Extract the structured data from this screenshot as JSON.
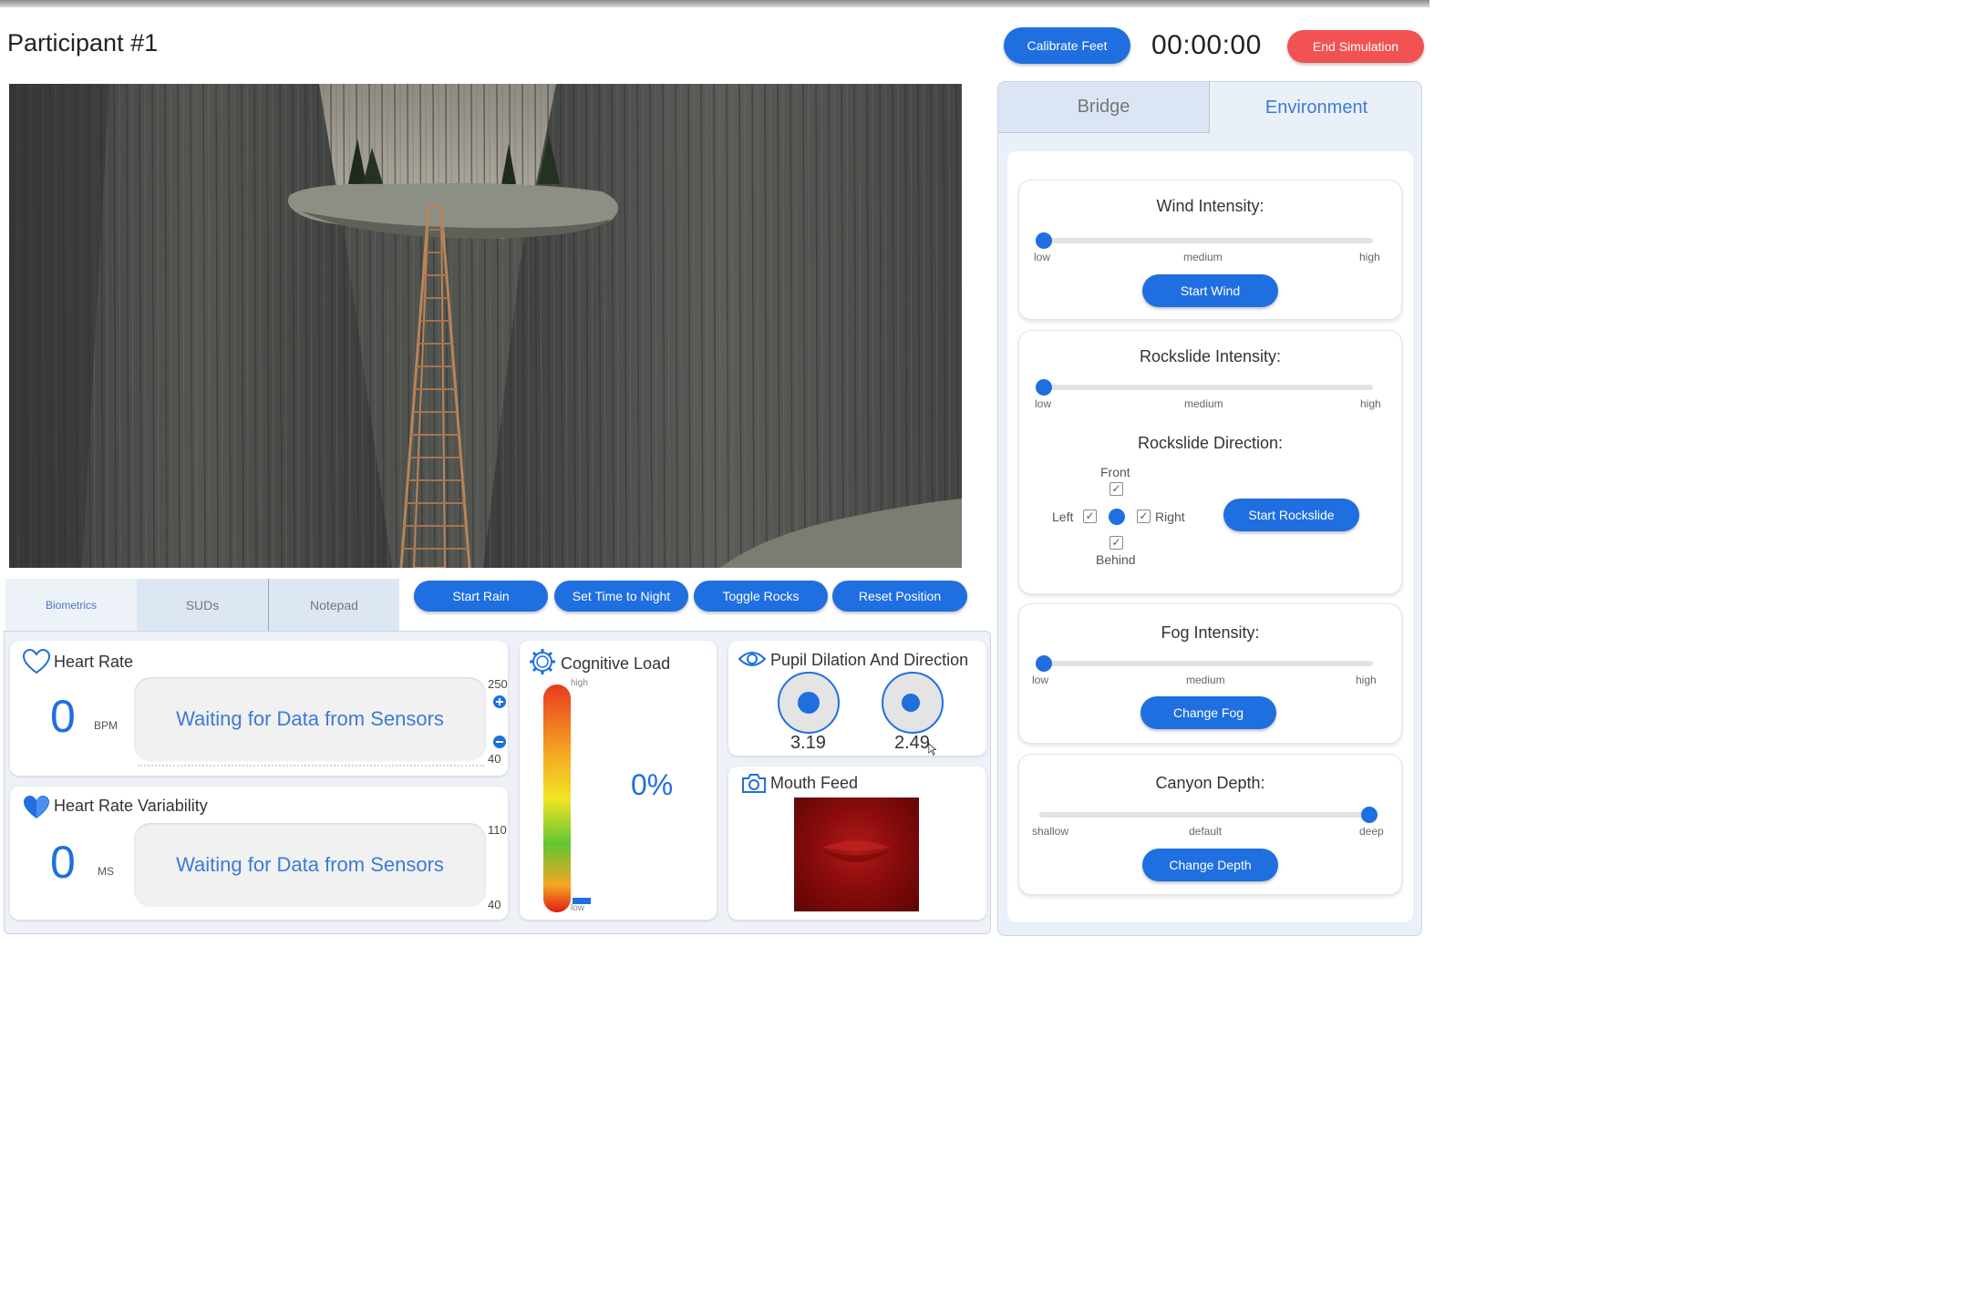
{
  "header": {
    "participant": "Participant #1",
    "calibrate_label": "Calibrate Feet",
    "timer": "00:00:00",
    "end_label": "End Simulation"
  },
  "bottom_tabs": [
    "Biometrics",
    "SUDs",
    "Notepad"
  ],
  "actions": [
    "Start Rain",
    "Set Time to Night",
    "Toggle Rocks",
    "Reset Position"
  ],
  "biometrics": {
    "heart_rate": {
      "title": "Heart Rate",
      "value": "0",
      "unit": "BPM",
      "status": "Waiting for Data from Sensors",
      "max": "250",
      "min": "40"
    },
    "hrv": {
      "title": "Heart Rate Variability",
      "value": "0",
      "unit": "MS",
      "status": "Waiting for Data from Sensors",
      "max": "110",
      "min": "40"
    },
    "cognitive": {
      "title": "Cognitive Load",
      "value": "0%",
      "high": "high",
      "low": "low"
    },
    "pupil": {
      "title": "Pupil Dilation And Direction",
      "left": "3.19",
      "right": "2.49"
    },
    "mouth": {
      "title": "Mouth Feed"
    }
  },
  "right_tabs": {
    "bridge": "Bridge",
    "environment": "Environment"
  },
  "environment": {
    "wind": {
      "title": "Wind Intensity:",
      "labels": [
        "low",
        "medium",
        "high"
      ],
      "level": 0.0,
      "button": "Start Wind"
    },
    "rockslide": {
      "title": "Rockslide Intensity:",
      "labels": [
        "low",
        "medium",
        "high"
      ],
      "level": 0.0,
      "direction_title": "Rockslide Direction:",
      "directions": {
        "front": "Front",
        "left": "Left",
        "right": "Right",
        "behind": "Behind"
      },
      "button": "Start Rockslide"
    },
    "fog": {
      "title": "Fog Intensity:",
      "labels": [
        "low",
        "medium",
        "high"
      ],
      "level": 0.0,
      "button": "Change Fog"
    },
    "depth": {
      "title": "Canyon Depth:",
      "labels": [
        "shallow",
        "default",
        "deep"
      ],
      "level": 1.0,
      "button": "Change Depth"
    }
  },
  "colors": {
    "accent": "#1f6fe0",
    "danger": "#f25252"
  }
}
